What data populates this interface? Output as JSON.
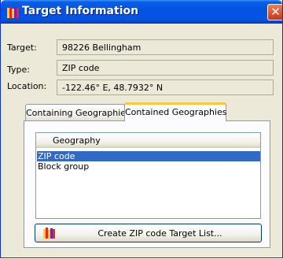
{
  "window": {
    "title": "Target Information",
    "close_glyph": "✕",
    "icon": "book-icon"
  },
  "fields": {
    "target": {
      "label": "Target:",
      "value": "98226  Bellingham"
    },
    "type": {
      "label": "Type:",
      "value": "ZIP code"
    },
    "location": {
      "label": "Location:",
      "value": "-122.46° E, 48.7932° N"
    }
  },
  "tabs": [
    {
      "label": "Containing Geographies",
      "active": false
    },
    {
      "label": "Contained Geographies",
      "active": true
    }
  ],
  "geography_list": {
    "header": "Geography",
    "items": [
      {
        "label": "ZIP code",
        "selected": true
      },
      {
        "label": "Block group",
        "selected": false
      }
    ]
  },
  "create_button": {
    "label": "Create ZIP code Target List...",
    "icon": "book-icon"
  },
  "colors": {
    "title_bar": "#0553e1",
    "selection": "#316ac5",
    "active_tab_accent": "#ffc83c"
  }
}
